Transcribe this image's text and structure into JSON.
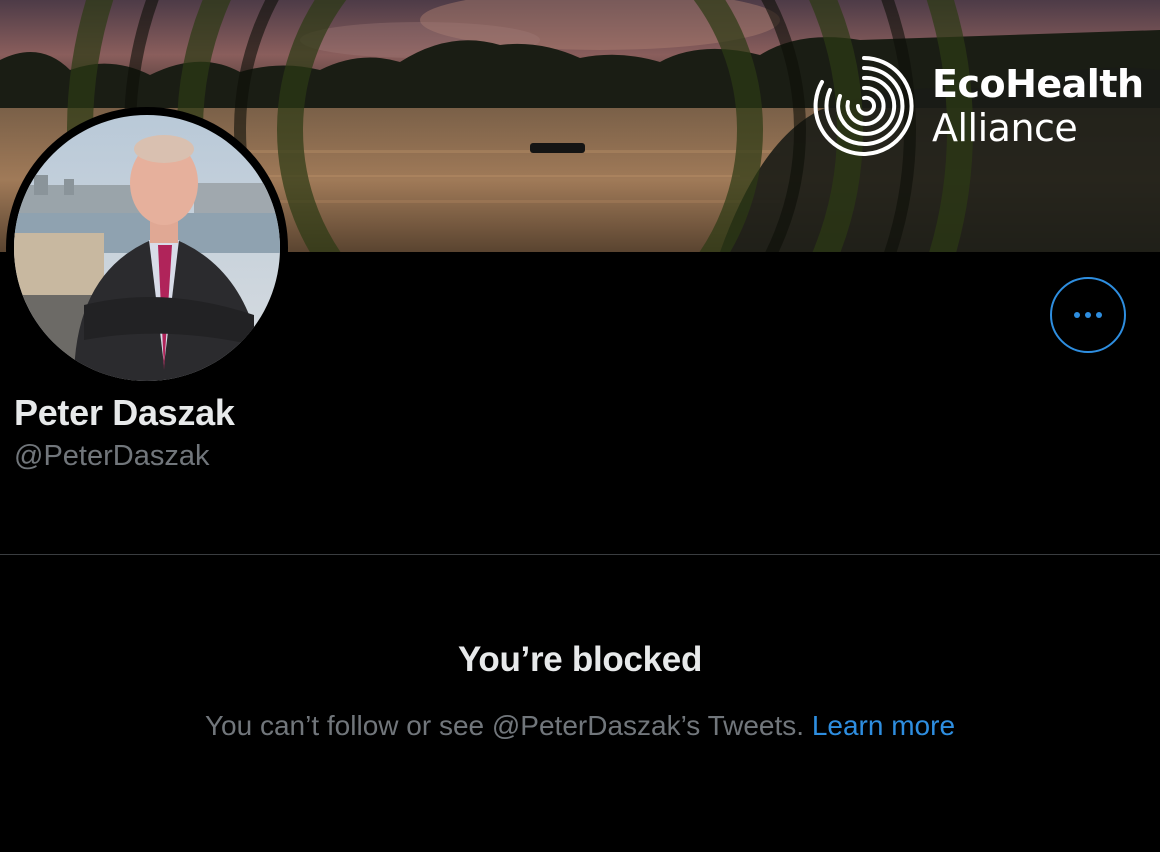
{
  "banner": {
    "logo_line1": "EcoHealth",
    "logo_line2": "Alliance"
  },
  "profile": {
    "display_name": "Peter Daszak",
    "handle": "@PeterDaszak"
  },
  "more_button": {
    "icon": "more-horizontal-icon"
  },
  "blocked": {
    "title": "You’re blocked",
    "message": "You can’t follow or see @PeterDaszak’s Tweets.",
    "link_label": "Learn more"
  },
  "colors": {
    "background": "#000000",
    "accent": "#2e8ee0",
    "primary_text": "#e7e9ea",
    "secondary_text": "#71767b"
  }
}
